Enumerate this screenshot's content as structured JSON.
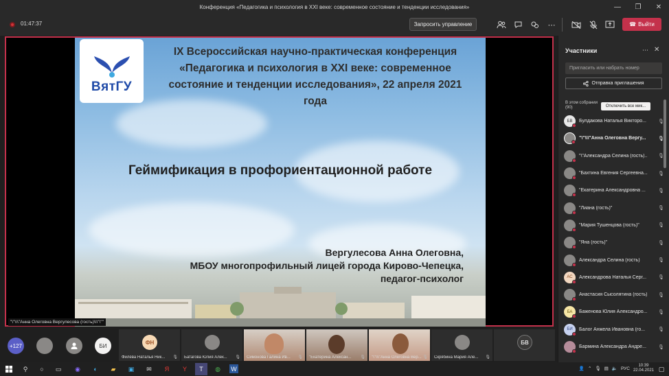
{
  "window": {
    "title": "Конференция «Педагогика и психология в XXI веке: современное состояние и тенденции исследования»",
    "minimize": "—",
    "restore": "❐",
    "close": "✕"
  },
  "toolbar": {
    "timer": "01:47:37",
    "request_control": "Запросить управление",
    "exit_label": "Выйти",
    "exit_icon": "phone-icon"
  },
  "slide": {
    "logo_text": "ВятГУ",
    "title": "IX Всероссийская научно-практическая конференция «Педагогика и психология в XXI веке: современное состояние и тенденции исследования», 22 апреля 2021 года",
    "topic": "Геймификация в профориентационной работе",
    "author_line1": "Вергулесова Анна Олеговна,",
    "author_line2": "МБОУ многопрофильный лицей города Кирово-Чепецка,",
    "author_line3": "педагог-психолог"
  },
  "presenter_tag": "\"\\\"\\\\\\\"Анна Олеговна Вергулесова (гость)\\\\\\\"\\\"\"",
  "filmstrip": {
    "overflow_count": "+127",
    "pill_initials": "БИ",
    "tiles": [
      {
        "initials": "ФН",
        "name": "Филёва Наталья Ник...",
        "type": "avatar",
        "color": "#e8b38a"
      },
      {
        "initials": "",
        "name": "Батагова Юлия Алек...",
        "type": "avatar",
        "color": "#8a8886"
      },
      {
        "initials": "",
        "name": "Симонова Галина Ив...",
        "type": "video",
        "color": "#b08a74"
      },
      {
        "initials": "",
        "name": "\"Екатерина Алексан...",
        "type": "video",
        "color": "#9a7d6a"
      },
      {
        "initials": "",
        "name": "\"\\\"\\\\\\\"Анна Олеговна Вер...",
        "type": "video",
        "color": "#c49a86"
      },
      {
        "initials": "",
        "name": "Скрябина Мария Але...",
        "type": "avatar",
        "color": "#8a8886"
      },
      {
        "initials": "БВ",
        "name": "",
        "type": "avatar",
        "color": "#444"
      }
    ]
  },
  "panel": {
    "title": "Участники",
    "invite_placeholder": "Пригласить или набрать номер",
    "share_invite": "Отправка приглашения",
    "in_meeting": "В этом собрании (90)",
    "mute_all": "Отключить все мик...",
    "participants": [
      {
        "initials": "БВ",
        "name": "Булдакова Наталья Викторо...",
        "av": "#e8e8e8",
        "fg": "#333",
        "mic": "🎙"
      },
      {
        "initials": "",
        "name": "\"\\\"\\\\\\\"Анна Олеговна Вергу...",
        "av": "#8a8886",
        "fg": "#fff",
        "mic": "🎙",
        "active": true
      },
      {
        "initials": "",
        "name": "\"\\\"Александра Селина (гость)...",
        "av": "#8a8886",
        "fg": "#fff",
        "mic": "🎙"
      },
      {
        "initials": "",
        "name": "\"Бахтина Евгения Сергеевна...",
        "av": "#8a8886",
        "fg": "#fff",
        "mic": "🎙"
      },
      {
        "initials": "",
        "name": "\"Екатерина Александровна ...",
        "av": "#8a8886",
        "fg": "#fff",
        "mic": "🎙"
      },
      {
        "initials": "",
        "name": "\"Лиана (гость)\"",
        "av": "#8a8886",
        "fg": "#fff",
        "mic": "🎙"
      },
      {
        "initials": "",
        "name": "\"Мария Тушенцова (гость)\"",
        "av": "#8a8886",
        "fg": "#fff",
        "mic": "🎙"
      },
      {
        "initials": "",
        "name": "\"Яна (гость)\"",
        "av": "#8a8886",
        "fg": "#fff",
        "mic": "🎙"
      },
      {
        "initials": "",
        "name": "Александра Селина (гость)",
        "av": "#8a8886",
        "fg": "#fff",
        "mic": "🎙"
      },
      {
        "initials": "АС",
        "name": "Александрова Наталья Серг...",
        "av": "#f2d7c0",
        "fg": "#8a4b1f",
        "mic": "🎙"
      },
      {
        "initials": "",
        "name": "Анастасия Сысолятина (гость)",
        "av": "#8a8886",
        "fg": "#fff",
        "mic": "🎙"
      },
      {
        "initials": "БА",
        "name": "Баженова Юлия Александро...",
        "av": "#f7e6a6",
        "fg": "#6b5a10",
        "mic": "🎙"
      },
      {
        "initials": "БИ",
        "name": "Балог Анжела Ивановна (го...",
        "av": "#c7d2f0",
        "fg": "#2d3f7a",
        "mic": "🎙"
      },
      {
        "initials": "",
        "name": "Бармина Александра Андре...",
        "av": "#b58c9a",
        "fg": "#fff",
        "mic": "🎙"
      }
    ]
  },
  "taskbar": {
    "lang": "РУС",
    "time": "10:39",
    "date": "22.04.2021"
  }
}
